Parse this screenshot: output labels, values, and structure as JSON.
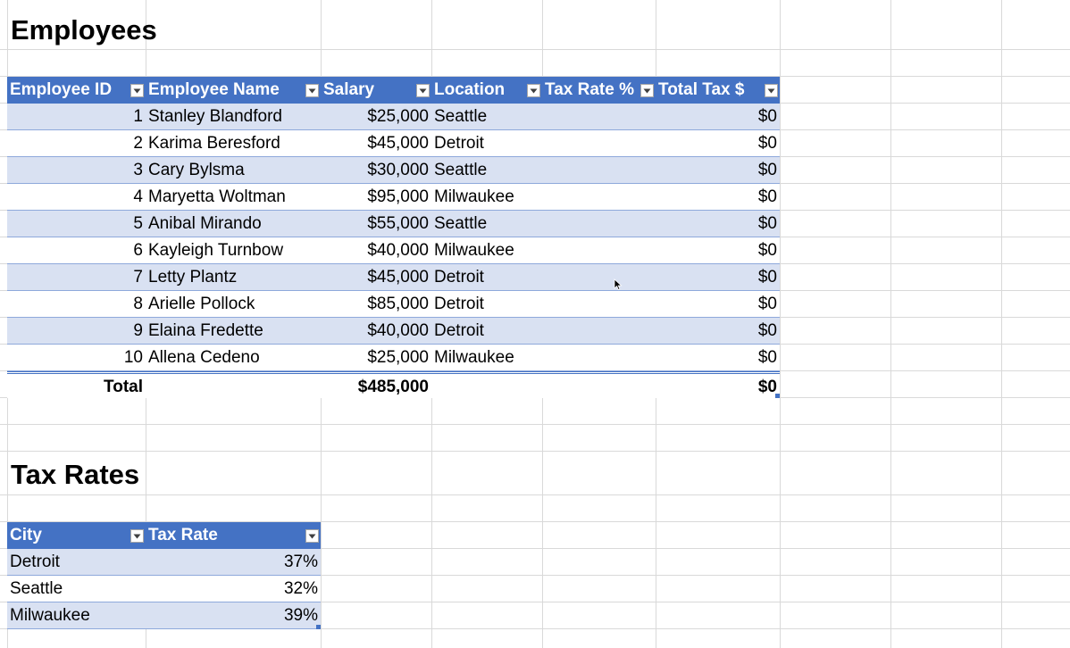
{
  "employees": {
    "title": "Employees",
    "columns": [
      "Employee ID",
      "Employee Name",
      "Salary",
      "Location",
      "Tax Rate %",
      "Total Tax $"
    ],
    "rows": [
      [
        "1",
        "Stanley Blandford",
        "$25,000",
        "Seattle",
        "",
        "$0"
      ],
      [
        "2",
        "Karima Beresford",
        "$45,000",
        "Detroit",
        "",
        "$0"
      ],
      [
        "3",
        "Cary Bylsma",
        "$30,000",
        "Seattle",
        "",
        "$0"
      ],
      [
        "4",
        "Maryetta Woltman",
        "$95,000",
        "Milwaukee",
        "",
        "$0"
      ],
      [
        "5",
        "Anibal Mirando",
        "$55,000",
        "Seattle",
        "",
        "$0"
      ],
      [
        "6",
        "Kayleigh Turnbow",
        "$40,000",
        "Milwaukee",
        "",
        "$0"
      ],
      [
        "7",
        "Letty Plantz",
        "$45,000",
        "Detroit",
        "",
        "$0"
      ],
      [
        "8",
        "Arielle Pollock",
        "$85,000",
        "Detroit",
        "",
        "$0"
      ],
      [
        "9",
        "Elaina Fredette",
        "$40,000",
        "Detroit",
        "",
        "$0"
      ],
      [
        "10",
        "Allena Cedeno",
        "$25,000",
        "Milwaukee",
        "",
        "$0"
      ]
    ],
    "total": {
      "label": "Total",
      "salary": "$485,000",
      "total_tax": "$0"
    }
  },
  "tax_rates": {
    "title": "Tax Rates",
    "columns": [
      "City",
      "Tax Rate"
    ],
    "rows": [
      [
        "Detroit",
        "37%"
      ],
      [
        "Seattle",
        "32%"
      ],
      [
        "Milwaukee",
        "39%"
      ]
    ]
  },
  "colors": {
    "header": "#4472c4",
    "band": "#d9e1f2",
    "gridline": "#d9d9d9"
  },
  "icons": {
    "filter": "filter-dropdown-icon",
    "cursor": "mouse-pointer-icon"
  }
}
